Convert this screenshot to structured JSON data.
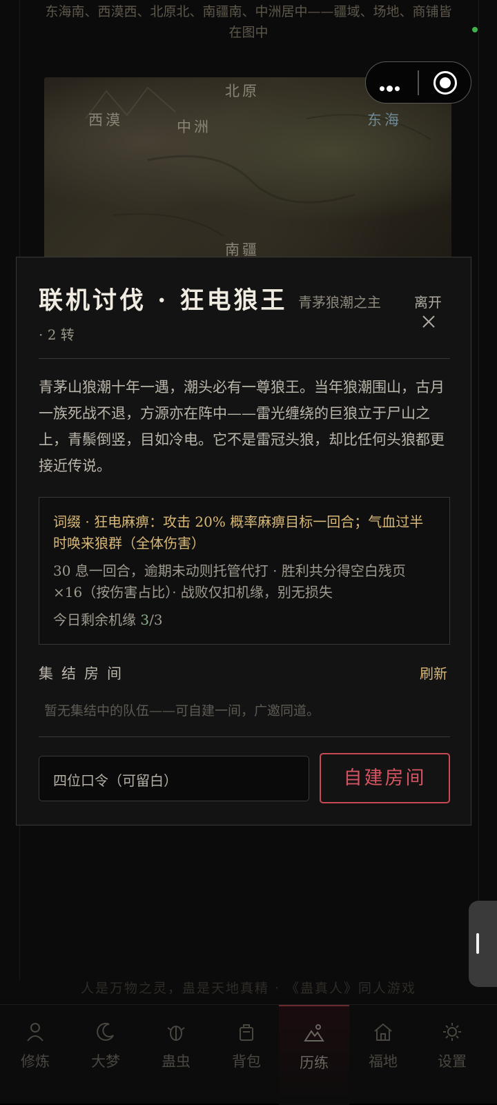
{
  "background": {
    "intro": "东海南、西漠西、北原北、南疆南、中洲居中——疆域、场地、商铺皆在图中",
    "map_labels": [
      "北原",
      "西漠",
      "中洲",
      "东海",
      "南疆"
    ]
  },
  "modal": {
    "title": "联机讨伐 · 狂电狼王",
    "subtitle": "青茅狼潮之主",
    "turn": "· 2 转",
    "leave_label": "离开",
    "description": "青茅山狼潮十年一遇，潮头必有一尊狼王。当年狼潮围山，古月一族死战不退，方源亦在阵中——雷光缠绕的巨狼立于尸山之上，青鬃倒竖，目如冷电。它不是雷冠头狼，却比任何头狼都更接近传说。",
    "affix": "词缀 · 狂电麻痹：攻击 20% 概率麻痹目标一回合；气血过半时唤来狼群（全体伤害）",
    "rules": "30 息一回合，逾期未动则托管代打 · 胜利共分得空白残页 ×16（按伤害占比）· 战败仅扣机缘，别无损失",
    "chances_label": "今日剩余机缘",
    "chances_value": "3",
    "chances_total": "/3",
    "rooms_label": "集结房间",
    "refresh_label": "刷新",
    "empty_rooms": "暂无集结中的队伍——可自建一间，广邀同道。",
    "password_placeholder": "四位口令（可留白）",
    "create_button": "自建房间"
  },
  "footer_slogan": "人是万物之灵，蛊是天地真精 · 《蛊真人》同人游戏",
  "tabs": [
    {
      "label": "修炼",
      "icon": "person-icon"
    },
    {
      "label": "大梦",
      "icon": "moon-icon"
    },
    {
      "label": "蛊虫",
      "icon": "bug-icon"
    },
    {
      "label": "背包",
      "icon": "bag-icon"
    },
    {
      "label": "历练",
      "icon": "mountain-icon",
      "active": true
    },
    {
      "label": "福地",
      "icon": "home-icon"
    },
    {
      "label": "设置",
      "icon": "sun-gear-icon"
    }
  ],
  "colors": {
    "accent_gold": "#d8b877",
    "accent_red": "#d45561",
    "active_tab": "#6a2a30"
  }
}
